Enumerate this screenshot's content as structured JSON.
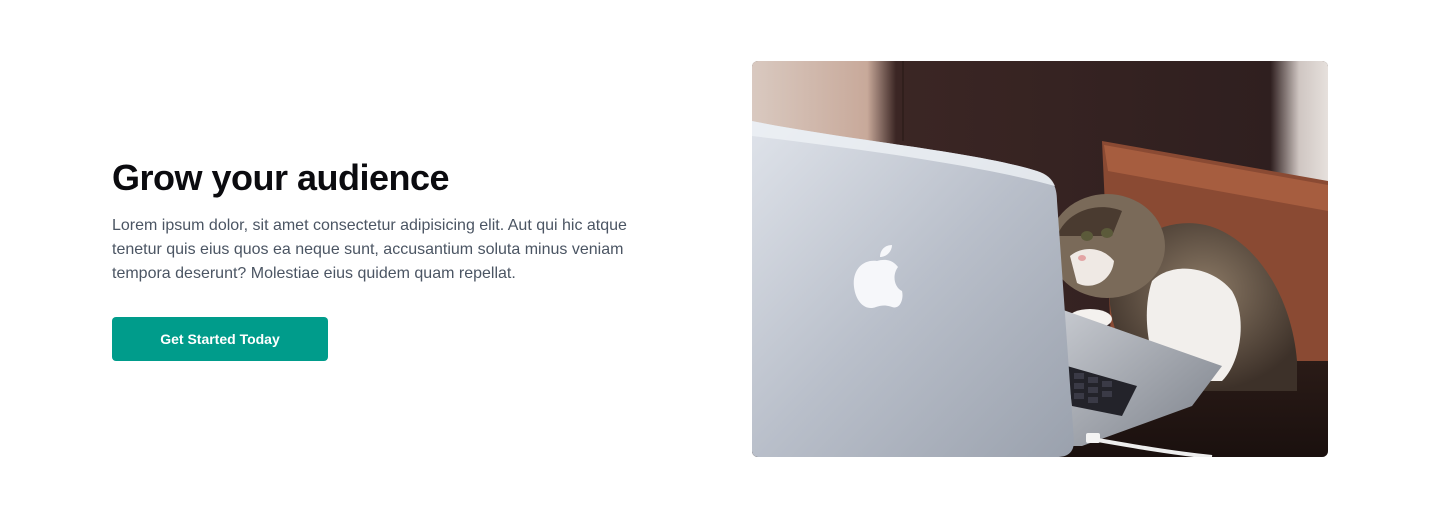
{
  "hero": {
    "title": "Grow your audience",
    "description": "Lorem ipsum dolor, sit amet consectetur adipisicing elit. Aut qui hic atque tenetur quis eius quos ea neque sunt, accusantium soluta minus veniam tempora deserunt? Molestiae eius quidem quam repellat.",
    "cta_label": "Get Started Today",
    "accent_color": "#009c8b"
  },
  "image": {
    "subject": "cat-using-laptop-photo"
  }
}
